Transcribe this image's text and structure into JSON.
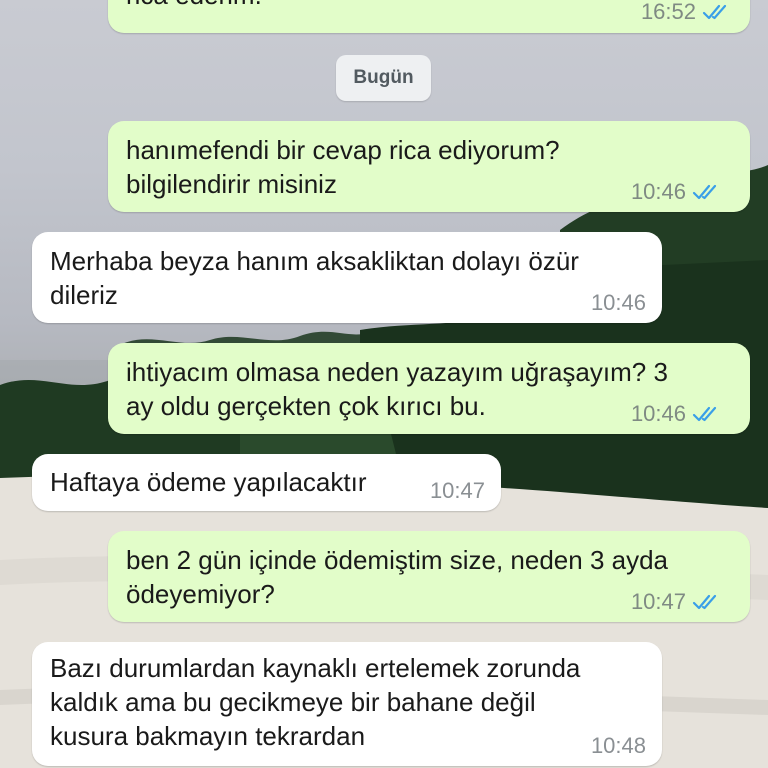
{
  "date_separator": "Bugün",
  "colors": {
    "outgoing_bubble": "#e2fdc9",
    "incoming_bubble": "#ffffff",
    "read_ticks": "#3a9fe8"
  },
  "messages": [
    {
      "direction": "out",
      "lines": [
        "rica ederim."
      ],
      "time": "16:52",
      "read": true
    },
    {
      "direction": "out",
      "lines": [
        "hanımefendi bir cevap rica ediyorum?",
        "bilgilendirir misiniz"
      ],
      "time": "10:46",
      "read": true
    },
    {
      "direction": "in",
      "lines": [
        "Merhaba beyza hanım aksakliktan dolayı özür",
        "dileriz"
      ],
      "time": "10:46"
    },
    {
      "direction": "out",
      "lines": [
        "ihtiyacım olmasa neden yazayım uğraşayım? 3",
        "ay oldu gerçekten çok kırıcı bu."
      ],
      "time": "10:46",
      "read": true
    },
    {
      "direction": "in",
      "lines": [
        "Haftaya ödeme yapılacaktır"
      ],
      "time": "10:47"
    },
    {
      "direction": "out",
      "lines": [
        "ben 2 gün içinde ödemiştim size, neden 3 ayda",
        "ödeyemiyor?"
      ],
      "time": "10:47",
      "read": true
    },
    {
      "direction": "in",
      "lines": [
        "Bazı durumlardan kaynaklı ertelemek zorunda",
        "kaldık ama bu gecikmeye bir bahane değil",
        "kusura bakmayın tekrardan"
      ],
      "time": "10:48"
    }
  ]
}
